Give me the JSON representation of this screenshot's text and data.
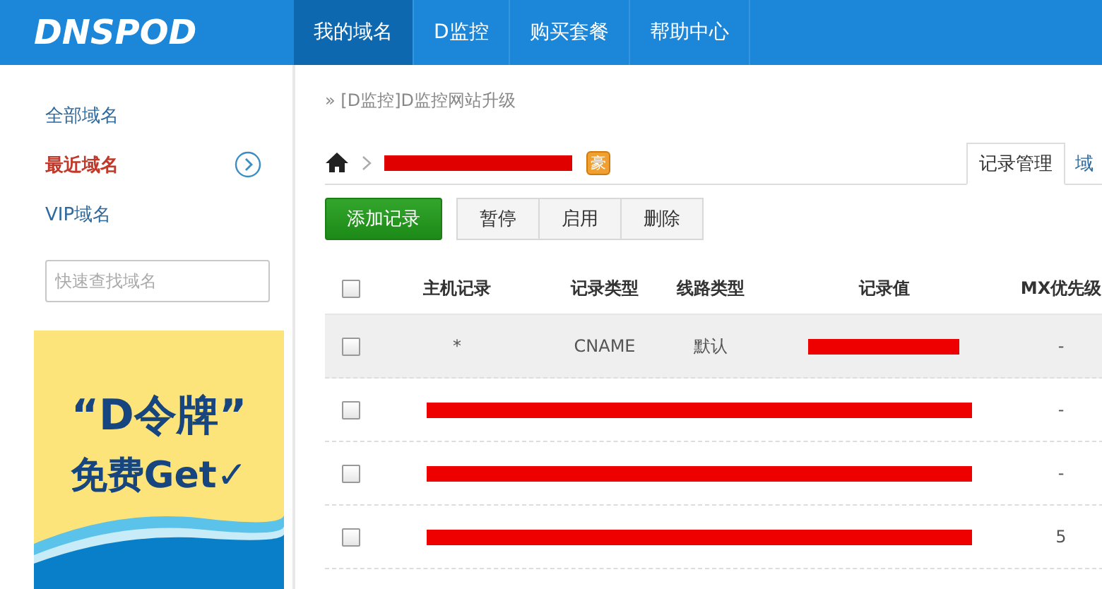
{
  "header": {
    "logo": "DNSPOD",
    "nav": [
      {
        "label": "我的域名",
        "selected": true
      },
      {
        "label": "D监控",
        "selected": false
      },
      {
        "label": "购买套餐",
        "selected": false
      },
      {
        "label": "帮助中心",
        "selected": false
      }
    ]
  },
  "sidebar": {
    "items": [
      {
        "label": "全部域名",
        "selected": false,
        "has_arrow": false
      },
      {
        "label": "最近域名",
        "selected": true,
        "has_arrow": true
      },
      {
        "label": "VIP域名",
        "selected": false,
        "has_arrow": false
      }
    ],
    "search": {
      "placeholder": "快速查找域名"
    },
    "banner": {
      "line_1": "“D令牌”",
      "line_2": "免费Get✓"
    }
  },
  "breadcrumb": "» [D监控]D监控网站升级",
  "domain": {
    "redacted": true,
    "badge": "豪"
  },
  "tabs": [
    {
      "label": "记录管理",
      "selected": true
    },
    {
      "label": "域",
      "selected": false
    }
  ],
  "toolbar": {
    "primary": "添加记录",
    "buttons": [
      "暂停",
      "启用",
      "删除"
    ]
  },
  "table": {
    "header_checked": false,
    "columns": [
      "主机记录",
      "记录类型",
      "线路类型",
      "记录值",
      "MX优先级"
    ],
    "rows": [
      {
        "kind": "record",
        "checked": false,
        "highlighted": true,
        "host": "*",
        "type": "CNAME",
        "line": "默认",
        "value_redacted": true,
        "mx": "-"
      },
      {
        "kind": "redacted",
        "checked": false,
        "highlighted": false,
        "mx": "-"
      },
      {
        "kind": "redacted",
        "checked": false,
        "highlighted": false,
        "mx": "-"
      },
      {
        "kind": "redacted",
        "checked": false,
        "highlighted": false,
        "mx": "5"
      }
    ]
  }
}
